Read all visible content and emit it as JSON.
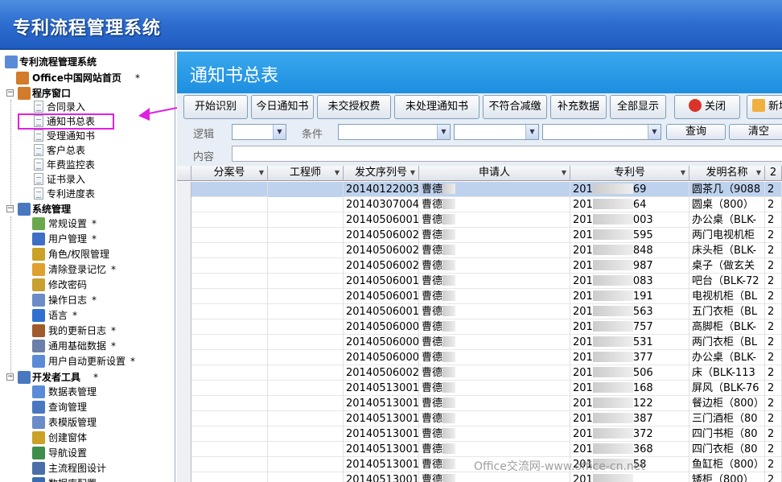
{
  "window": {
    "title": "专利流程管理系统"
  },
  "sidebar": {
    "root": "专利流程管理系统",
    "home": "Office中国网站首页",
    "home_star": "*",
    "section_programs": "程序窗口",
    "programs": [
      "合同录入",
      "通知书总表",
      "受理通知书",
      "客户总表",
      "年费监控表",
      "证书录入",
      "专利进度表"
    ],
    "section_system": "系统管理",
    "system": [
      {
        "label": "常规设置",
        "star": "*",
        "icon": "gear-icon"
      },
      {
        "label": "用户管理",
        "star": "*",
        "icon": "user-icon"
      },
      {
        "label": "角色/权限管理",
        "star": "",
        "icon": "lock-icon"
      },
      {
        "label": "清除登录记忆",
        "star": "*",
        "icon": "folder-icon"
      },
      {
        "label": "修改密码",
        "star": "",
        "icon": "key-icon"
      },
      {
        "label": "操作日志",
        "star": "*",
        "icon": "magnifier-icon"
      },
      {
        "label": "语言",
        "star": "*",
        "icon": "info-icon"
      },
      {
        "label": "我的更新日志",
        "star": "*",
        "icon": "tools-icon"
      },
      {
        "label": "通用基础数据",
        "star": "*",
        "icon": "data-icon"
      },
      {
        "label": "用户自动更新设置",
        "star": "*",
        "icon": "doc-icon"
      }
    ],
    "section_dev": "开发者工具",
    "dev_star": "*",
    "dev": [
      "数据表管理",
      "查询管理",
      "表模版管理",
      "创建窗体",
      "导航设置",
      "主流程图设计",
      "数据库配置"
    ]
  },
  "main": {
    "title": "通知书总表",
    "toolbar": [
      "开始识别",
      "今日通知书",
      "未交授权费",
      "未处理通知书",
      "不符合减缴",
      "补充数据",
      "全部显示",
      "关闭",
      "新增"
    ],
    "filter": {
      "logic_label": "逻辑",
      "condition_label": "条件",
      "content_label": "内容",
      "query": "查询",
      "clear": "清空"
    },
    "columns": [
      "分案号",
      "工程师",
      "发文序列号",
      "申请人",
      "专利号",
      "发明名称",
      "2"
    ],
    "rows": [
      {
        "serial": "20140122003",
        "applicant": "曹德",
        "patent_a": "201",
        "patent_b": "69",
        "name": "圆茶几（9088",
        "tail": "2"
      },
      {
        "serial": "20140307004",
        "applicant": "曹德",
        "patent_a": "201",
        "patent_b": "64",
        "name": "圆桌（800）",
        "tail": "2"
      },
      {
        "serial": "20140506001",
        "applicant": "曹德",
        "patent_a": "201",
        "patent_b": "003",
        "name": "办公桌（BLK-",
        "tail": "2"
      },
      {
        "serial": "20140506002",
        "applicant": "曹德",
        "patent_a": "201",
        "patent_b": "595",
        "name": "两门电视机柜",
        "tail": "2"
      },
      {
        "serial": "20140506002",
        "applicant": "曹德",
        "patent_a": "201",
        "patent_b": "848",
        "name": "床头柜（BLK-",
        "tail": "2"
      },
      {
        "serial": "20140506002",
        "applicant": "曹德",
        "patent_a": "201",
        "patent_b": "987",
        "name": "桌子（做玄关",
        "tail": "2"
      },
      {
        "serial": "20140506001",
        "applicant": "曹德",
        "patent_a": "201",
        "patent_b": "083",
        "name": "吧台（BLK-72",
        "tail": "2"
      },
      {
        "serial": "20140506001",
        "applicant": "曹德",
        "patent_a": "201",
        "patent_b": "191",
        "name": "电视机柜（BL",
        "tail": "2"
      },
      {
        "serial": "20140506001",
        "applicant": "曹德",
        "patent_a": "201",
        "patent_b": "563",
        "name": "五门衣柜（BL",
        "tail": "2"
      },
      {
        "serial": "20140506000",
        "applicant": "曹德",
        "patent_a": "201",
        "patent_b": "757",
        "name": "高脚柜（BLK-",
        "tail": "2"
      },
      {
        "serial": "20140506000",
        "applicant": "曹德",
        "patent_a": "201",
        "patent_b": "531",
        "name": "两门衣柜（BL",
        "tail": "2"
      },
      {
        "serial": "20140506000",
        "applicant": "曹德",
        "patent_a": "201",
        "patent_b": "377",
        "name": "办公桌（BLK-",
        "tail": "2"
      },
      {
        "serial": "20140506002",
        "applicant": "曹德",
        "patent_a": "201",
        "patent_b": "506",
        "name": "床（BLK-113",
        "tail": "2"
      },
      {
        "serial": "20140513001",
        "applicant": "曹德",
        "patent_a": "201",
        "patent_b": "168",
        "name": "屏风（BLK-76",
        "tail": "2"
      },
      {
        "serial": "20140513001",
        "applicant": "曹德",
        "patent_a": "201",
        "patent_b": "122",
        "name": "餐边柜（800）",
        "tail": "2"
      },
      {
        "serial": "20140513001",
        "applicant": "曹德",
        "patent_a": "201",
        "patent_b": "387",
        "name": "三门酒柜（80",
        "tail": "2"
      },
      {
        "serial": "20140513001",
        "applicant": "曹德",
        "patent_a": "201",
        "patent_b": "372",
        "name": "四门书柜（80",
        "tail": "2"
      },
      {
        "serial": "20140513001",
        "applicant": "曹德",
        "patent_a": "201",
        "patent_b": "368",
        "name": "四门衣柜（80",
        "tail": "2"
      },
      {
        "serial": "20140513001",
        "applicant": "曹德",
        "patent_a": "201",
        "patent_b": "58",
        "name": "鱼缸柜（800）",
        "tail": "2"
      },
      {
        "serial": "20140513001",
        "applicant": "曹德",
        "patent_a": "201",
        "patent_b": "",
        "name": "矮柜（800）",
        "tail": "2"
      }
    ]
  },
  "watermark": "Office交流网-www.office-cn.net",
  "colors": {
    "title_bar": "#2f6fd0",
    "header": "#1e8ee0",
    "highlight": "#e020e0",
    "selected_row": "#bed2ee"
  }
}
